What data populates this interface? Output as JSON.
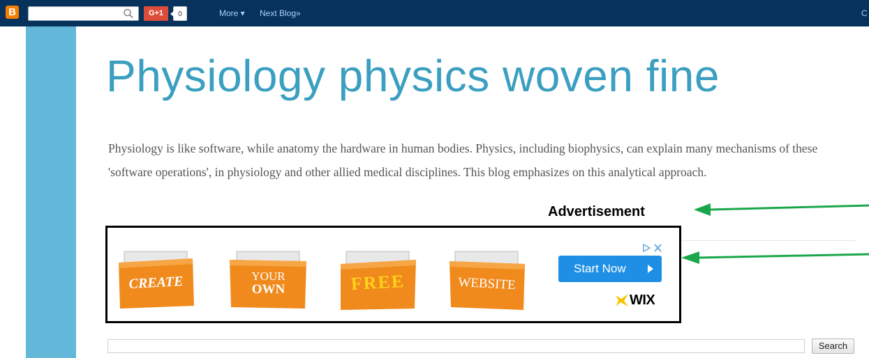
{
  "navbar": {
    "logo_letter": "B",
    "gplus_label": "G+1",
    "gplus_count": "0",
    "more_label": "More ▾",
    "next_blog_label": "Next Blog»",
    "right_link_label": "C"
  },
  "blog": {
    "title": "Physiology physics woven fine",
    "description": "Physiology is like software, while anatomy the hardware in human bodies. Physics, including biophysics, can explain many mechanisms of these 'software operations', in physiology and other allied medical disciplines. This blog emphasizes on this analytical approach."
  },
  "annotation": {
    "label": "Advertisement",
    "arrow_color": "#1aa64a"
  },
  "ad": {
    "folders": [
      "CREATE",
      "YOUR OWN",
      "FREE",
      "WEBSITE"
    ],
    "folder_line1": [
      "CREATE",
      "YOUR",
      "FREE",
      "WEBSITE"
    ],
    "folder_line2": [
      "",
      "OWN",
      "",
      ""
    ],
    "cta_label": "Start Now",
    "brand": "WIX",
    "folder_color": "#f08a1c",
    "cta_color": "#1f8fe6"
  },
  "search": {
    "input_value": "",
    "button_label": "Search"
  },
  "colors": {
    "navbar": "#07325c",
    "sidebar_band": "#63b7d9",
    "title": "#3a9fc0"
  }
}
